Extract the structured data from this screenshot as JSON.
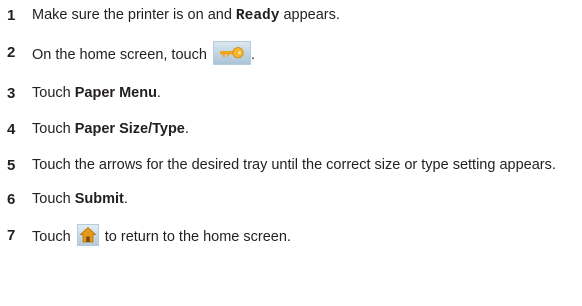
{
  "steps": [
    {
      "num": "1",
      "pre": "Make sure the printer is on and ",
      "code": "Ready",
      "post": " appears."
    },
    {
      "num": "2",
      "pre": "On the home screen, touch ",
      "post": ".",
      "icon": "menu-key-icon"
    },
    {
      "num": "3",
      "pre": "Touch ",
      "bold": "Paper Menu",
      "post": "."
    },
    {
      "num": "4",
      "pre": "Touch ",
      "bold": "Paper Size/Type",
      "post": "."
    },
    {
      "num": "5",
      "text": "Touch the arrows for the desired tray until the correct size or type setting appears."
    },
    {
      "num": "6",
      "pre": "Touch ",
      "bold": "Submit",
      "post": "."
    },
    {
      "num": "7",
      "pre": "Touch ",
      "post": " to return to the home screen.",
      "icon": "home-icon"
    }
  ],
  "colors": {
    "text": "#231f20",
    "icon_bg": "#c2d6e4",
    "key_gold": "#f0a41e"
  }
}
